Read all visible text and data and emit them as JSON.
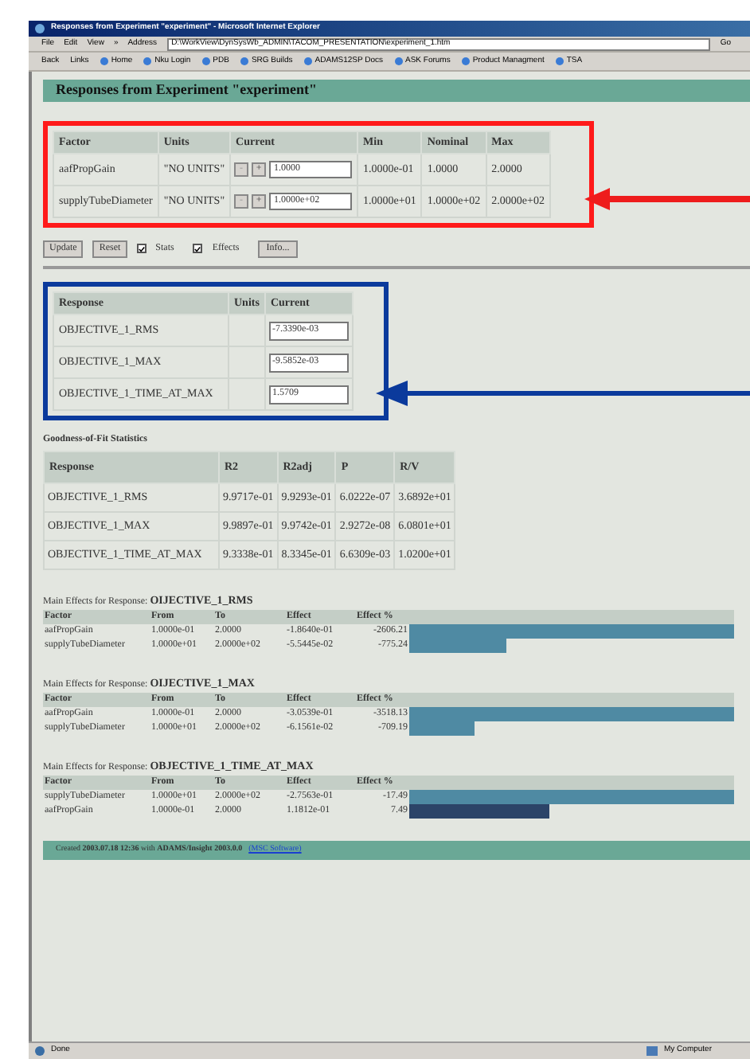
{
  "window": {
    "title": "Responses from Experiment \"experiment\" - Microsoft Internet Explorer"
  },
  "menu": [
    "File",
    "Edit",
    "View",
    "»"
  ],
  "address": {
    "label": "Address",
    "value": "D:\\WorkView\\DynSysWb_ADMIN\\TACOM_PRESENTATION\\experiment_1.htm",
    "go": "Go"
  },
  "toolbar": {
    "back": "Back",
    "links_label": "Links",
    "links": [
      "Home",
      "Nku Login",
      "PDB",
      "SRG Builds",
      "ADAMS12SP Docs",
      "ASK Forums",
      "Product Managment",
      "TSA"
    ]
  },
  "heading": "Responses from Experiment \"experiment\"",
  "factors": {
    "columns": [
      "Factor",
      "Units",
      "Current",
      "Min",
      "Nominal",
      "Max"
    ],
    "rows": [
      {
        "name": "aafPropGain",
        "units": "\"NO UNITS\"",
        "minus": "-",
        "plus": "+",
        "current": "1.0000",
        "min": "1.0000e-01",
        "nominal": "1.0000",
        "max": "2.0000"
      },
      {
        "name": "supplyTubeDiameter",
        "units": "\"NO UNITS\"",
        "minus": "-",
        "plus": "+",
        "current": "1.0000e+02",
        "min": "1.0000e+01",
        "nominal": "1.0000e+02",
        "max": "2.0000e+02"
      }
    ]
  },
  "controls": {
    "update": "Update",
    "reset": "Reset",
    "options": [
      {
        "label": "Stats",
        "checked": true
      },
      {
        "label": "Effects",
        "checked": true
      }
    ],
    "info": "Info..."
  },
  "responses": {
    "columns": [
      "Response",
      "Units",
      "Current"
    ],
    "rows": [
      {
        "name": "OBJECTIVE_1_RMS",
        "current": "-7.3390e-03"
      },
      {
        "name": "OBJECTIVE_1_MAX",
        "current": "-9.5852e-03"
      },
      {
        "name": "OBJECTIVE_1_TIME_AT_MAX",
        "current": "1.5709"
      }
    ]
  },
  "fit": {
    "title": "Goodness-of-Fit Statistics",
    "columns": [
      "Response",
      "R2",
      "R2adj",
      "P",
      "R/V"
    ],
    "rows": [
      [
        "OBJECTIVE_1_RMS",
        "9.9717e-01",
        "9.9293e-01",
        "6.0222e-07",
        "3.6892e+01"
      ],
      [
        "OBJECTIVE_1_MAX",
        "9.9897e-01",
        "9.9742e-01",
        "2.9272e-08",
        "6.0801e+01"
      ],
      [
        "OBJECTIVE_1_TIME_AT_MAX",
        "9.3338e-01",
        "8.3345e-01",
        "6.6309e-03",
        "1.0200e+01"
      ]
    ]
  },
  "effects": [
    {
      "prefix": "Main Effects for Response:",
      "response": "OIJECTIVE_1_RMS",
      "columns": [
        "Factor",
        "From",
        "To",
        "Effect",
        "Effect %"
      ],
      "rows": [
        {
          "factor": "aafPropGain",
          "from": "1.0000e-01",
          "to": "2.0000",
          "effect": "-1.8640e-01",
          "percent": "-2606.21",
          "level": 1,
          "color": "#4f8aa3"
        },
        {
          "factor": "supplyTubeDiameter",
          "from": "1.0000e+01",
          "to": "2.0000e+02",
          "effect": "-5.5445e-02",
          "percent": "-775.24",
          "level": 0.3,
          "color": "#4f8aa3"
        }
      ]
    },
    {
      "prefix": "Main Effects for Response:",
      "response": "OIJECTIVE_1_MAX",
      "columns": [
        "Factor",
        "From",
        "To",
        "Effect",
        "Effect %"
      ],
      "rows": [
        {
          "factor": "aafPropGain",
          "from": "1.0000e-01",
          "to": "2.0000",
          "effect": "-3.0539e-01",
          "percent": "-3518.13",
          "level": 1,
          "color": "#4f8aa3"
        },
        {
          "factor": "supplyTubeDiameter",
          "from": "1.0000e+01",
          "to": "2.0000e+02",
          "effect": "-6.1561e-02",
          "percent": "-709.19",
          "level": 0.2,
          "color": "#4f8aa3"
        }
      ]
    },
    {
      "prefix": "Main Effects for Response:",
      "response": "OBJECTIVE_1_TIME_AT_MAX",
      "columns": [
        "Factor",
        "From",
        "To",
        "Effect",
        "Effect %"
      ],
      "rows": [
        {
          "factor": "supplyTubeDiameter",
          "from": "1.0000e+01",
          "to": "2.0000e+02",
          "effect": "-2.7563e-01",
          "percent": "-17.49",
          "level": 1,
          "color": "#4f8aa3"
        },
        {
          "factor": "aafPropGain",
          "from": "1.0000e-01",
          "to": "2.0000",
          "effect": "1.1812e-01",
          "percent": "7.49",
          "level": 0.43,
          "color": "#2c4468"
        }
      ]
    }
  ],
  "footer": {
    "text": "Created **2003.07.18 12:36** with **ADAMS/Insight 2003.0.0**",
    "link": "(MSC Software)"
  },
  "status_bar": {
    "text": "Done",
    "zone": "My Computer"
  }
}
